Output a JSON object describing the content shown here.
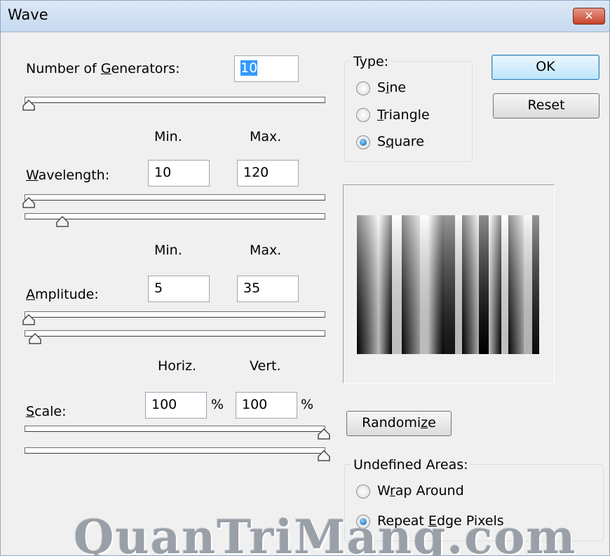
{
  "window": {
    "title": "Wave",
    "close_glyph": "✕"
  },
  "generators": {
    "label": "Number of Generators:",
    "value": "10",
    "slider_value": 10
  },
  "wavelength": {
    "col_min": "Min.",
    "col_max": "Max.",
    "label": "Wavelength:",
    "min": "10",
    "max": "120"
  },
  "amplitude": {
    "col_min": "Min.",
    "col_max": "Max.",
    "label": "Amplitude:",
    "min": "5",
    "max": "35"
  },
  "scale": {
    "col_horiz": "Horiz.",
    "col_vert": "Vert.",
    "label": "Scale:",
    "horiz": "100",
    "vert": "100",
    "unit": "%"
  },
  "type": {
    "label": "Type:",
    "options": [
      "Sine",
      "Triangle",
      "Square"
    ],
    "selected": "Square"
  },
  "buttons": {
    "ok": "OK",
    "reset": "Reset",
    "randomize": "Randomize"
  },
  "undefined_areas": {
    "label": "Undefined Areas:",
    "options": [
      "Wrap Around",
      "Repeat Edge Pixels"
    ],
    "selected": "Repeat Edge Pixels"
  },
  "watermark": "QuanTriMang.com",
  "colors": {
    "accent": "#3399ff",
    "title_bg": "#c7daf0",
    "dialog_bg": "#f0f0f0"
  },
  "icons": {
    "close": "close-icon",
    "slider_thumb": "triangle-thumb-icon"
  }
}
